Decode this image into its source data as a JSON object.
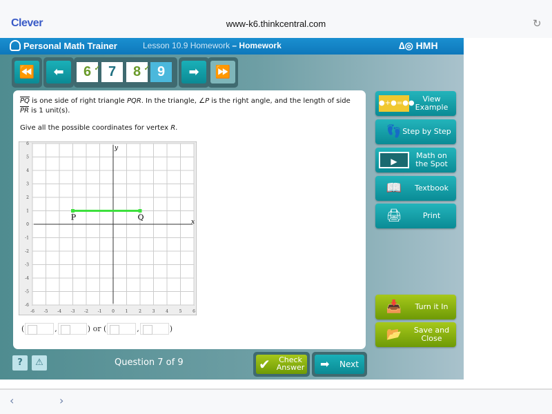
{
  "browser": {
    "brand": "Clever",
    "url": "www-k6.thinkcentral.com",
    "reload_icon": "reload-icon"
  },
  "header": {
    "app_title": "Personal Math Trainer",
    "lesson": "Lesson 10.9 Homework",
    "separator": " – ",
    "assignment_type": "Homework",
    "publisher": "HMH"
  },
  "nav": {
    "first": "⏪",
    "prev": "⬅",
    "next": "➡",
    "last": "⏩",
    "questions": [
      {
        "label": "6",
        "state": "answered"
      },
      {
        "label": "7",
        "state": "current"
      },
      {
        "label": "8",
        "state": "answered"
      },
      {
        "label": "9",
        "state": "unanswered"
      }
    ],
    "check_mark": "✓"
  },
  "question": {
    "segment_pq": "PQ",
    "t1": " is one side of right triangle ",
    "pqr": "PQR",
    "t2": ". In the triangle, ",
    "angle": "∠P",
    "t3": " is the right angle, and the length of side ",
    "segment_pr": "PR",
    "t4": " is 1 unit(s).",
    "prompt": "Give all the possible coordinates for vertex ",
    "vertex": "R",
    "prompt_end": "."
  },
  "graph": {
    "x_range": [
      -6,
      6
    ],
    "y_range": [
      -6,
      6
    ],
    "x_axis_label": "x",
    "y_axis_label": "y",
    "grid": true,
    "segment_color": "#3de03d",
    "points": [
      {
        "label": "P",
        "x": -3,
        "y": 1
      },
      {
        "label": "Q",
        "x": 2,
        "y": 1
      }
    ]
  },
  "answers": {
    "open": "(",
    "comma": ",",
    "close": ")",
    "or": " or ",
    "values": [
      "",
      "",
      "",
      ""
    ]
  },
  "side": {
    "view_example": "View Example",
    "step_by_step": "Step by Step",
    "math_on_spot": "Math on the Spot",
    "textbook": "Textbook",
    "print": "Print",
    "turn_in": "Turn it In",
    "save_close": "Save and Close"
  },
  "footer": {
    "help": "?",
    "alert": "⚠",
    "status": "Question 7 of 9",
    "check_answer": "Check Answer",
    "next": "Next"
  },
  "tabbar": {
    "back": "‹",
    "forward": "›"
  }
}
